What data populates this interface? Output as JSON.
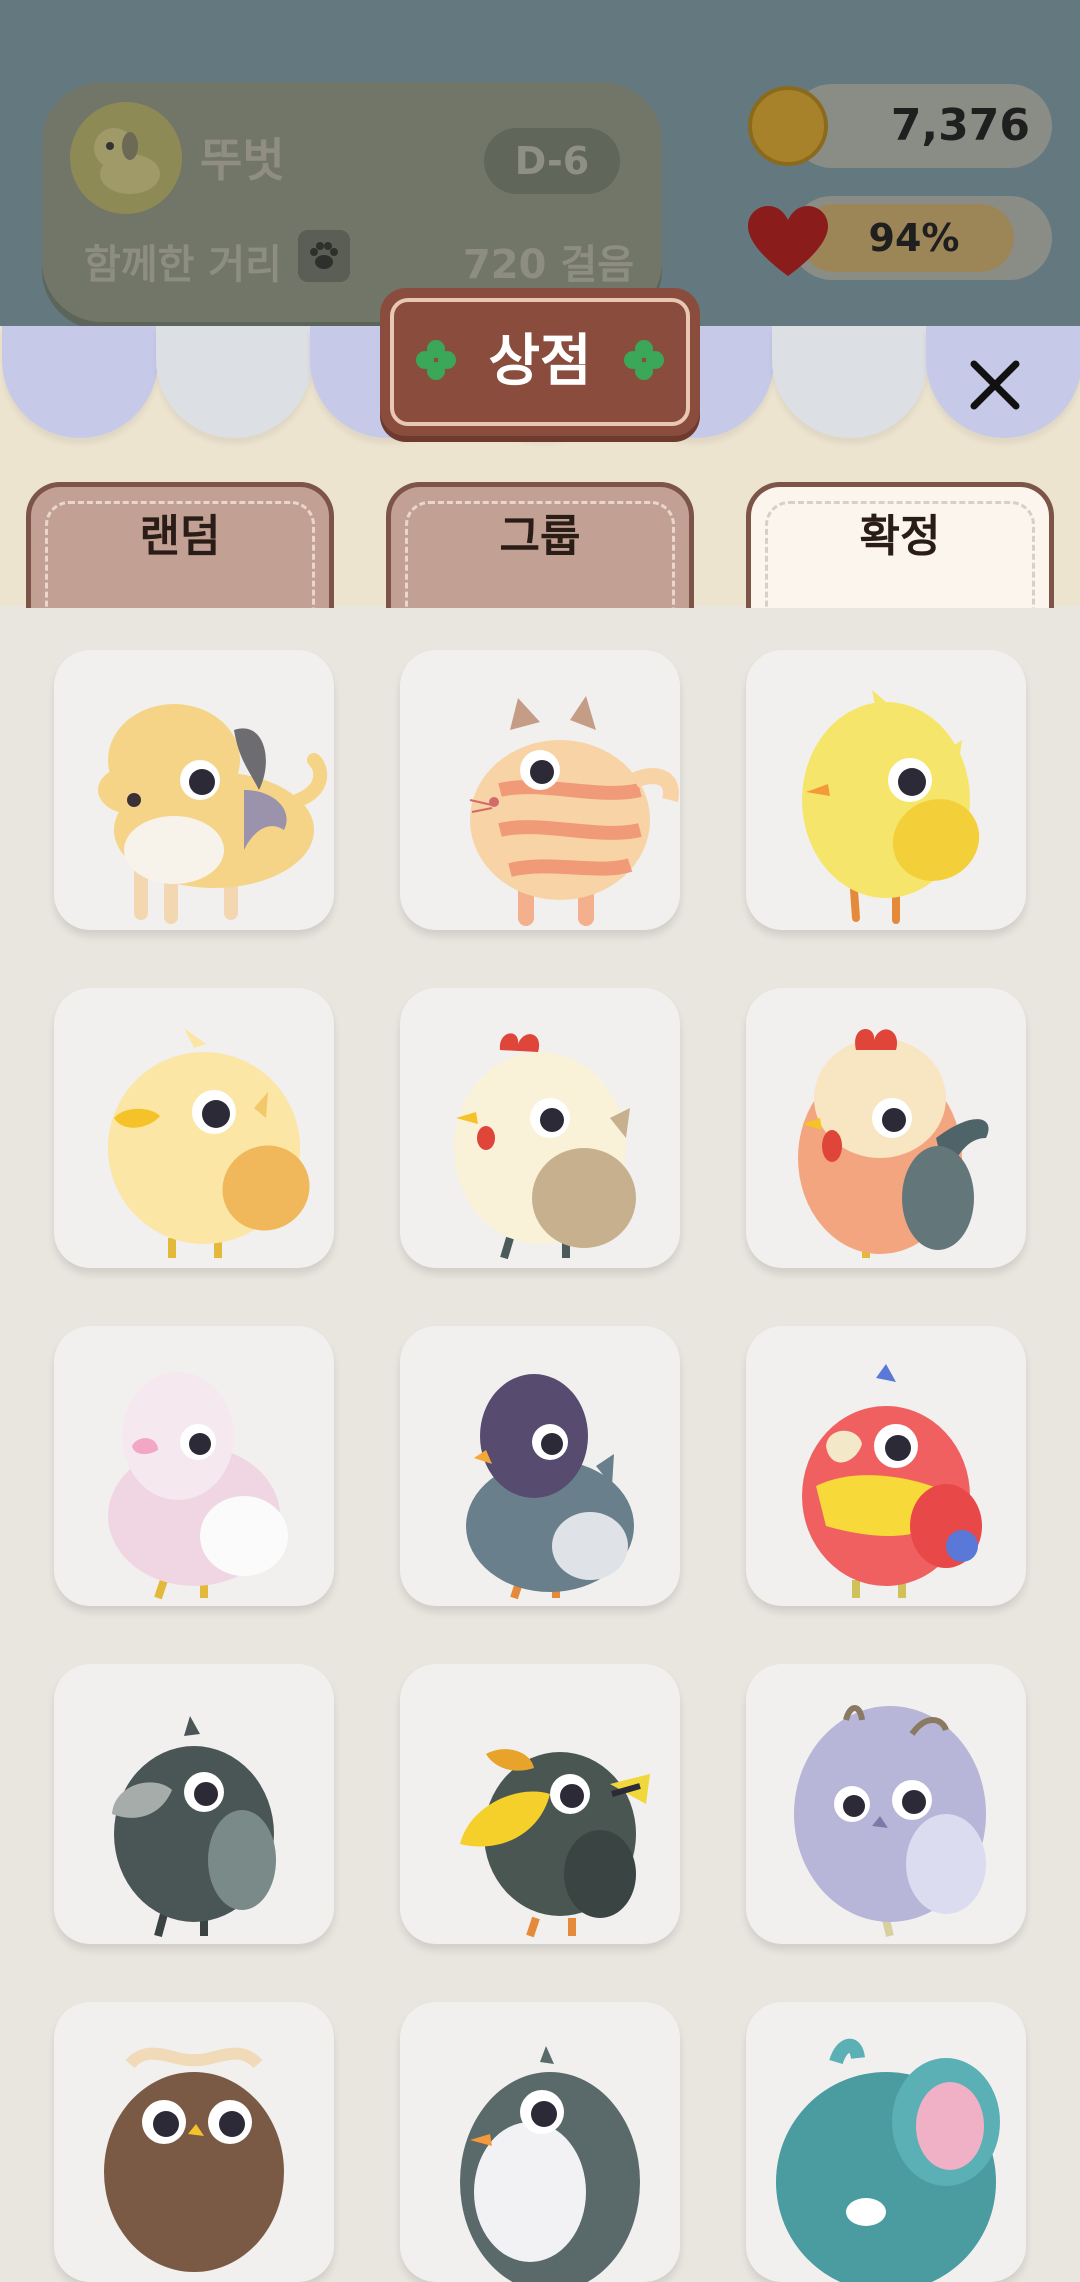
{
  "profile": {
    "pet_name": "뚜벗",
    "d_day": "D-6",
    "distance_label": "함께한 거리",
    "steps": "720 걸음"
  },
  "currency": {
    "coins": "7,376",
    "heart_percent": "94%",
    "heart_level": 0.94
  },
  "shop": {
    "title": "상점",
    "tabs": [
      {
        "label": "랜덤",
        "active": false
      },
      {
        "label": "그룹",
        "active": false
      },
      {
        "label": "확정",
        "active": true
      }
    ]
  },
  "items": [
    {
      "name": "dog-icon"
    },
    {
      "name": "cat-icon"
    },
    {
      "name": "chick-icon"
    },
    {
      "name": "duckling-icon"
    },
    {
      "name": "hen-icon"
    },
    {
      "name": "rooster-icon"
    },
    {
      "name": "pink-pigeon-icon"
    },
    {
      "name": "pigeon-icon"
    },
    {
      "name": "parrot-icon"
    },
    {
      "name": "crow-icon"
    },
    {
      "name": "hornbill-icon"
    },
    {
      "name": "owl-icon"
    },
    {
      "name": "brown-owl-icon"
    },
    {
      "name": "penguin-icon"
    },
    {
      "name": "elephant-icon"
    }
  ],
  "colors": {
    "tab_border": "#7c5448",
    "plaque": "#8a4c3c",
    "awning_blue": "#c6cae8",
    "card_bg": "#f1f0ef"
  }
}
